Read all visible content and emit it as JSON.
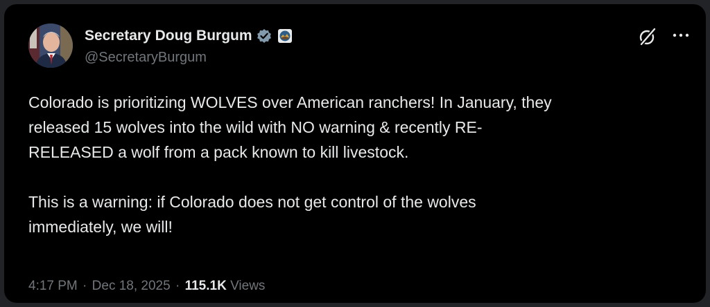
{
  "tweet": {
    "author": {
      "display_name": "Secretary Doug Burgum",
      "handle": "@SecretaryBurgum",
      "verified_badge_icon": "verified-badge-icon",
      "affiliation_icon": "interior-department-seal-icon",
      "verified_color": "#829aab"
    },
    "actions": {
      "grok_icon": "grok-icon",
      "more_icon": "more-dots-icon"
    },
    "body": {
      "paragraph_1": "Colorado is prioritizing WOLVES over American ranchers! In January, they\nreleased 15 wolves into the wild with NO warning & recently RE-\nRELEASED a wolf from a pack known to kill livestock.",
      "paragraph_2": "This is a warning: if Colorado does not get control of the wolves\nimmediately, we will!"
    },
    "meta": {
      "time": "4:17 PM",
      "separator": "·",
      "date": "Dec 18, 2025",
      "views_count": "115.1K",
      "views_label": "Views"
    }
  },
  "colors": {
    "background": "#000000",
    "text_primary": "#e7e9ea",
    "text_secondary": "#71767b"
  }
}
